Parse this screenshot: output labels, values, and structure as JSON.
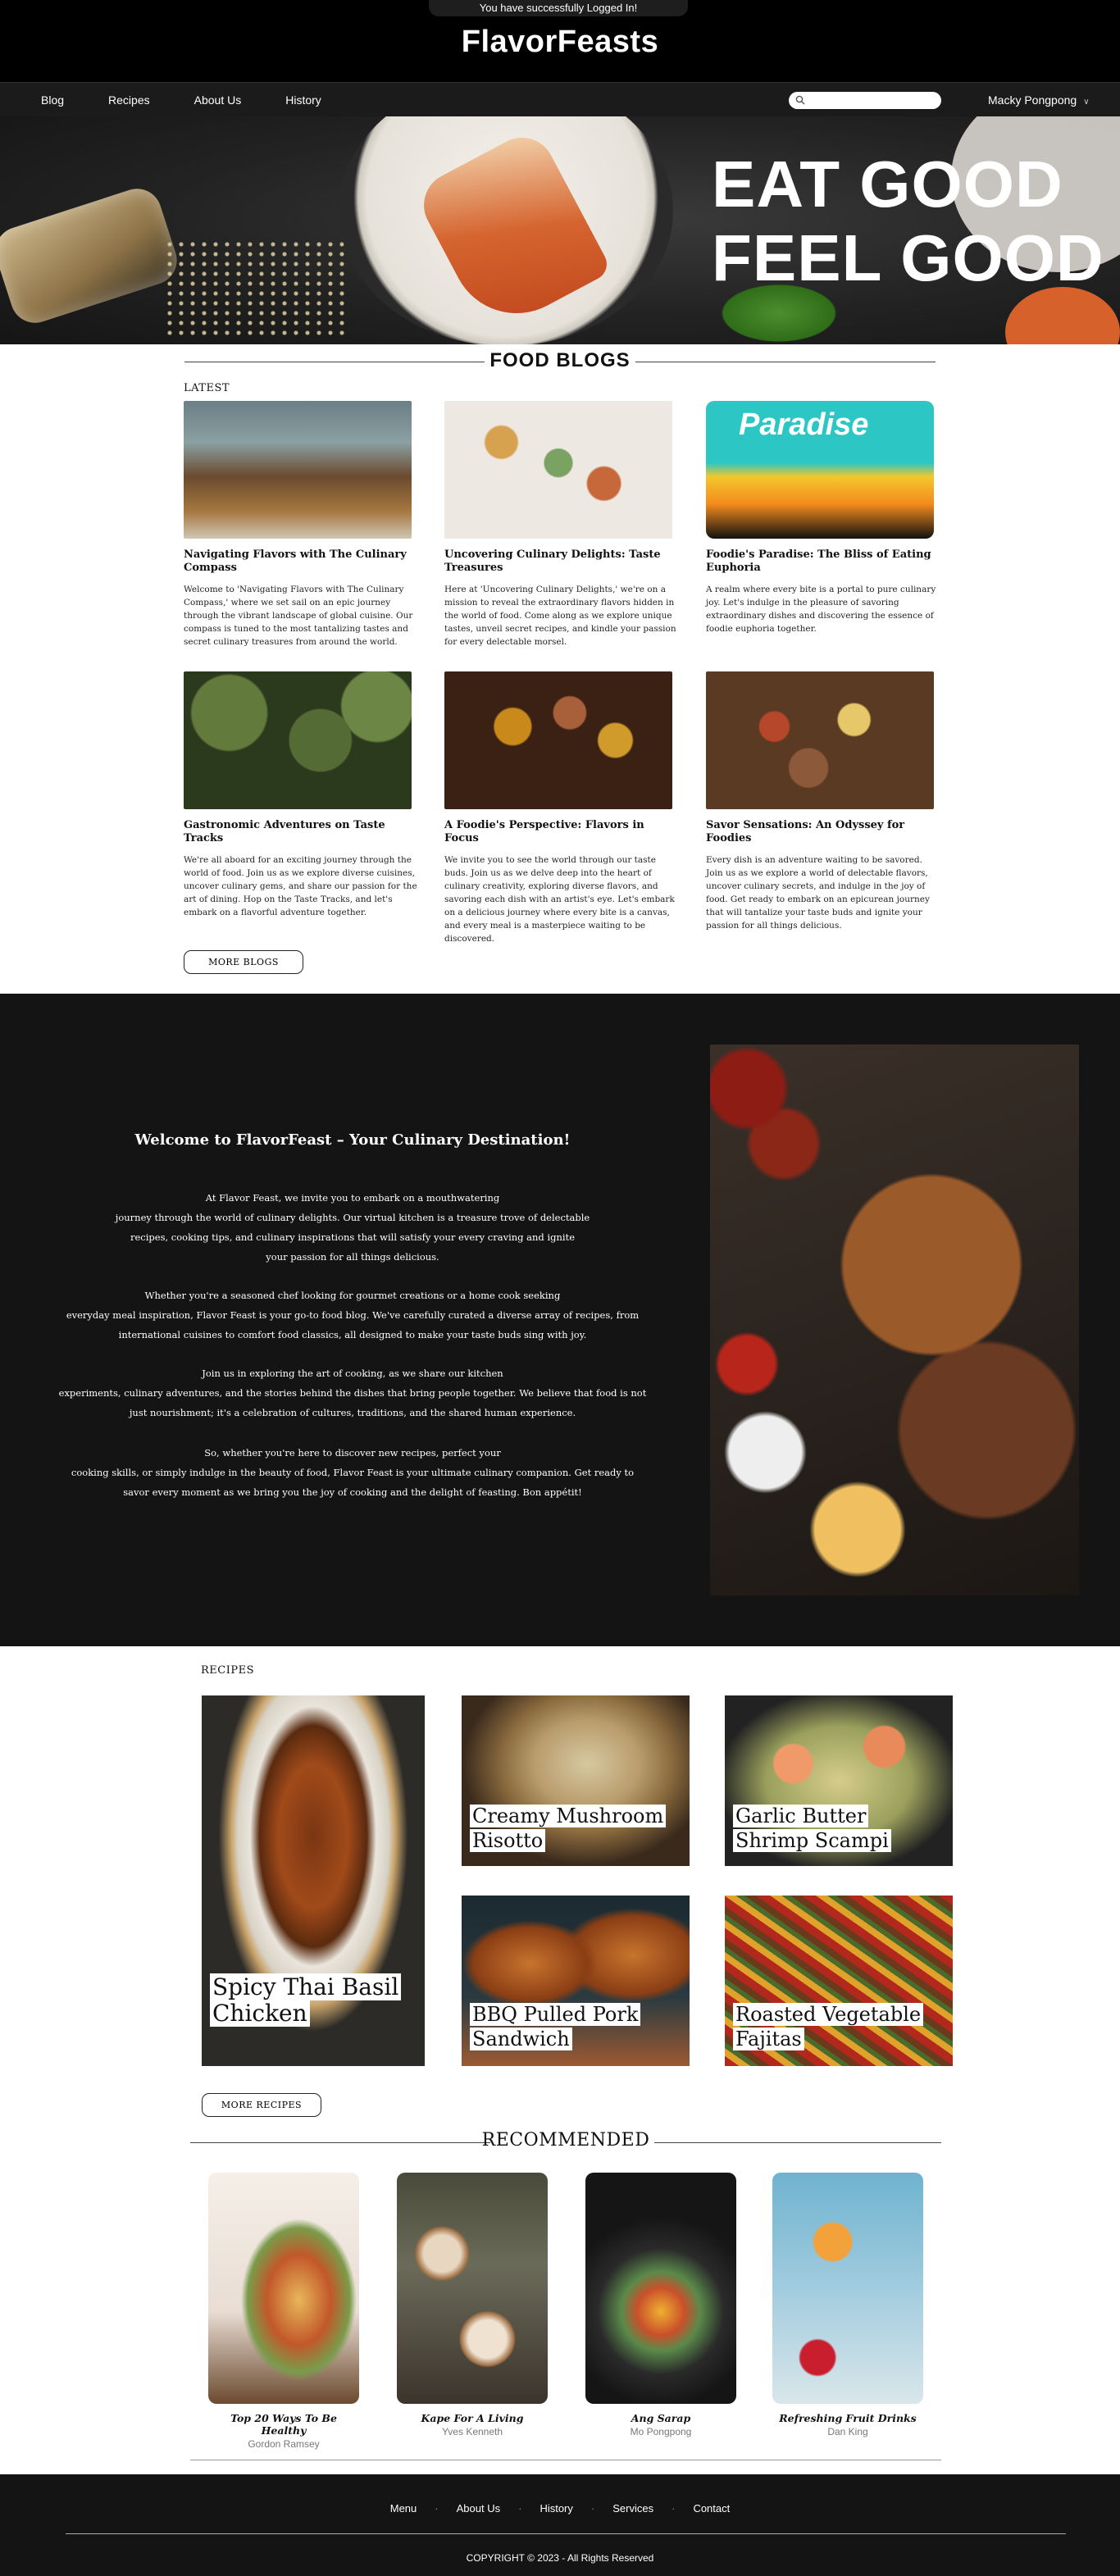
{
  "toast": "You have successfully Logged In!",
  "brand": "FlavorFeasts",
  "nav": {
    "links": [
      "Blog",
      "Recipes",
      "About Us",
      "History"
    ],
    "search_placeholder": "",
    "user": "Macky Pongpong"
  },
  "hero": {
    "line1": "EAT GOOD",
    "line2": "FEEL GOOD"
  },
  "blogs": {
    "title": "FOOD BLOGS",
    "latest_label": "LATEST",
    "more_button": "MORE BLOGS",
    "items": [
      {
        "title": "Navigating Flavors with The Culinary Compass",
        "text": "Welcome to 'Navigating Flavors with The Culinary Compass,' where we set sail on an epic journey through the vibrant landscape of global cuisine. Our compass is tuned to the most tantalizing tastes and secret culinary treasures from around the world."
      },
      {
        "title": "Uncovering Culinary Delights: Taste Treasures",
        "text": "Here at 'Uncovering Culinary Delights,' we're on a mission to reveal the extraordinary flavors hidden in the world of food. Come along as we explore unique tastes, unveil secret recipes, and kindle your passion for every delectable morsel."
      },
      {
        "title": "Foodie's Paradise: The Bliss of Eating Euphoria",
        "text": " A realm where every bite is a portal to pure culinary joy. Let's indulge in the pleasure of savoring extraordinary dishes and discovering the essence of foodie euphoria together.",
        "sign": "Paradise"
      },
      {
        "title": "Gastronomic Adventures on Taste Tracks",
        "text": "We're all aboard for an exciting journey through the world of food. Join us as we explore diverse cuisines, uncover culinary gems, and share our passion for the art of dining. Hop on the Taste Tracks, and let's embark on a flavorful adventure together."
      },
      {
        "title": "A Foodie's Perspective: Flavors in Focus",
        "text": "We invite you to see the world through our taste buds. Join us as we delve deep into the heart of culinary creativity, exploring diverse flavors, and savoring each dish with an artist's eye. Let's embark on a delicious journey where every bite is a canvas, and every meal is a masterpiece waiting to be discovered."
      },
      {
        "title": "Savor Sensations: An Odyssey for Foodies",
        "text": "Every dish is an adventure waiting to be savored. Join us as we explore a world of delectable flavors, uncover culinary secrets, and indulge in the joy of food. Get ready to embark on an epicurean journey that will tantalize your taste buds and ignite your passion for all things delicious."
      }
    ]
  },
  "welcome": {
    "title": "Welcome to FlavorFeast – Your Culinary Destination!",
    "paragraphs": [
      [
        "At Flavor Feast, we invite you to embark on a mouthwatering",
        "journey through the world of culinary delights.  Our virtual kitchen is a treasure trove of delectable",
        "recipes, cooking tips, and culinary inspirations that will satisfy your every craving and ignite",
        "your passion for all things delicious."
      ],
      [
        "Whether you're a seasoned chef looking for gourmet creations or a home cook seeking",
        "everyday meal inspiration, Flavor Feast is your go-to food blog. We've carefully curated a diverse array of recipes, from",
        "international cuisines to comfort food classics, all designed to make your taste buds sing with joy."
      ],
      [
        "Join us in exploring the art of cooking, as we share our kitchen",
        "experiments, culinary adventures, and the stories  behind the dishes that bring people together. We believe that food is not",
        "just nourishment; it's a celebration of cultures, traditions, and the shared human experience."
      ],
      [
        "So, whether you're here to discover new recipes, perfect your",
        "cooking skills, or simply indulge in the beauty of food, Flavor Feast is your ultimate culinary companion. Get ready to",
        "savor every moment as we bring you the joy of cooking and the delight of feasting. Bon appétit!"
      ]
    ]
  },
  "recipes": {
    "label": "RECIPES",
    "more_button": "MORE RECIPES",
    "items": [
      {
        "line1": "Spicy Thai Basil",
        "line2": "Chicken"
      },
      {
        "line1": "Creamy Mushroom",
        "line2": "Risotto"
      },
      {
        "line1": "Garlic Butter",
        "line2": "Shrimp Scampi"
      },
      {
        "line1": "BBQ Pulled Pork",
        "line2": "Sandwich"
      },
      {
        "line1": "Roasted Vegetable",
        "line2": "Fajitas"
      }
    ]
  },
  "recommended": {
    "title": "RECOMMENDED",
    "items": [
      {
        "title": "Top 20 Ways To Be Healthy",
        "author": "Gordon Ramsey"
      },
      {
        "title": "Kape For A Living",
        "author": "Yves Kenneth"
      },
      {
        "title": "Ang Sarap",
        "author": "Mo Pongpong"
      },
      {
        "title": "Refreshing Fruit Drinks",
        "author": "Dan King"
      }
    ]
  },
  "footer": {
    "links": [
      "Menu",
      "About Us",
      "History",
      "Services",
      "Contact"
    ],
    "copyright": "COPYRIGHT © 2023 - All Rights Reserved"
  }
}
